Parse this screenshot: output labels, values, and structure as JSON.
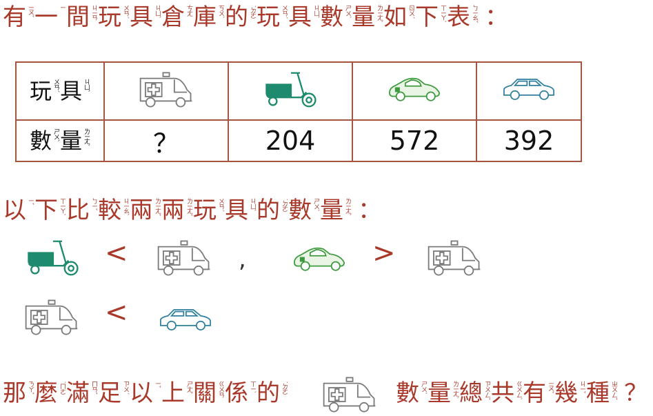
{
  "intro": {
    "chars": [
      {
        "c": "有",
        "z": "ㄧㄡˇ"
      },
      {
        "c": "一",
        "z": "ㄧ"
      },
      {
        "c": "間",
        "z": "ㄐㄧㄢ"
      },
      {
        "c": "玩",
        "z": "ㄨㄢˊ"
      },
      {
        "c": "具",
        "z": "ㄐㄩˋ"
      },
      {
        "c": "倉",
        "z": "ㄘㄤ"
      },
      {
        "c": "庫",
        "z": "ㄎㄨˋ"
      },
      {
        "c": "的",
        "z": "˙ㄉㄜ"
      },
      {
        "c": "玩",
        "z": "ㄨㄢˊ"
      },
      {
        "c": "具",
        "z": "ㄐㄩˋ"
      },
      {
        "c": "數",
        "z": "ㄕㄨˋ"
      },
      {
        "c": "量",
        "z": "ㄌㄧㄤˋ"
      },
      {
        "c": "如",
        "z": "ㄖㄨˊ"
      },
      {
        "c": "下",
        "z": "ㄒㄧㄚˋ"
      },
      {
        "c": "表",
        "z": "ㄅㄧㄠˇ"
      }
    ],
    "colon": "："
  },
  "table": {
    "row1_head": [
      {
        "c": "玩",
        "z": "ㄨㄢˊ"
      },
      {
        "c": "具",
        "z": "ㄐㄩˋ"
      }
    ],
    "row2_head": [
      {
        "c": "數",
        "z": "ㄕㄨˋ"
      },
      {
        "c": "量",
        "z": "ㄌㄧㄤˋ"
      }
    ],
    "toys": [
      "ambulance-icon",
      "scooter-icon",
      "sports-car-icon",
      "sedan-icon"
    ],
    "counts": [
      "？",
      "204",
      "572",
      "392"
    ]
  },
  "compare": {
    "chars": [
      {
        "c": "以",
        "z": "ㄧˇ"
      },
      {
        "c": "下",
        "z": "ㄒㄧㄚˋ"
      },
      {
        "c": "比",
        "z": "ㄅㄧˇ"
      },
      {
        "c": "較",
        "z": "ㄐㄧㄠˋ"
      },
      {
        "c": "兩",
        "z": "ㄌㄧㄤˇ"
      },
      {
        "c": "兩",
        "z": "ㄌㄧㄤˇ"
      },
      {
        "c": "玩",
        "z": "ㄨㄢˊ"
      },
      {
        "c": "具",
        "z": "ㄐㄩˋ"
      },
      {
        "c": "的",
        "z": "˙ㄉㄜ"
      },
      {
        "c": "數",
        "z": "ㄕㄨˋ"
      },
      {
        "c": "量",
        "z": "ㄌㄧㄤˋ"
      }
    ],
    "colon": "：",
    "less_than": "<",
    "greater_than": ">",
    "comma": ","
  },
  "question": {
    "before": [
      {
        "c": "那",
        "z": "ㄋㄚˇ"
      },
      {
        "c": "麼",
        "z": "˙ㄇㄜ"
      },
      {
        "c": "滿",
        "z": "ㄇㄢˇ"
      },
      {
        "c": "足",
        "z": "ㄗㄨˊ"
      },
      {
        "c": "以",
        "z": "ㄧˇ"
      },
      {
        "c": "上",
        "z": "ㄕㄤˋ"
      },
      {
        "c": "關",
        "z": "ㄍㄨㄢ"
      },
      {
        "c": "係",
        "z": "ㄒㄧˋ"
      },
      {
        "c": "的",
        "z": "˙ㄉㄜ"
      }
    ],
    "after": [
      {
        "c": "數",
        "z": "ㄕㄨˋ"
      },
      {
        "c": "量",
        "z": "ㄌㄧㄤˋ"
      },
      {
        "c": "總",
        "z": "ㄗㄨㄥˇ"
      },
      {
        "c": "共",
        "z": "ㄍㄨㄥˋ"
      },
      {
        "c": "有",
        "z": "ㄧㄡˇ"
      },
      {
        "c": "幾",
        "z": "ㄐㄧˇ"
      },
      {
        "c": "種",
        "z": "ㄓㄨㄥˇ"
      }
    ],
    "mark": "？"
  },
  "colors": {
    "text": "#a93a2b",
    "ambulance": "#7a7a7a",
    "scooter": "#1e8a6e",
    "sports_car": "#3f9a3f",
    "sedan": "#2f7f9e"
  }
}
